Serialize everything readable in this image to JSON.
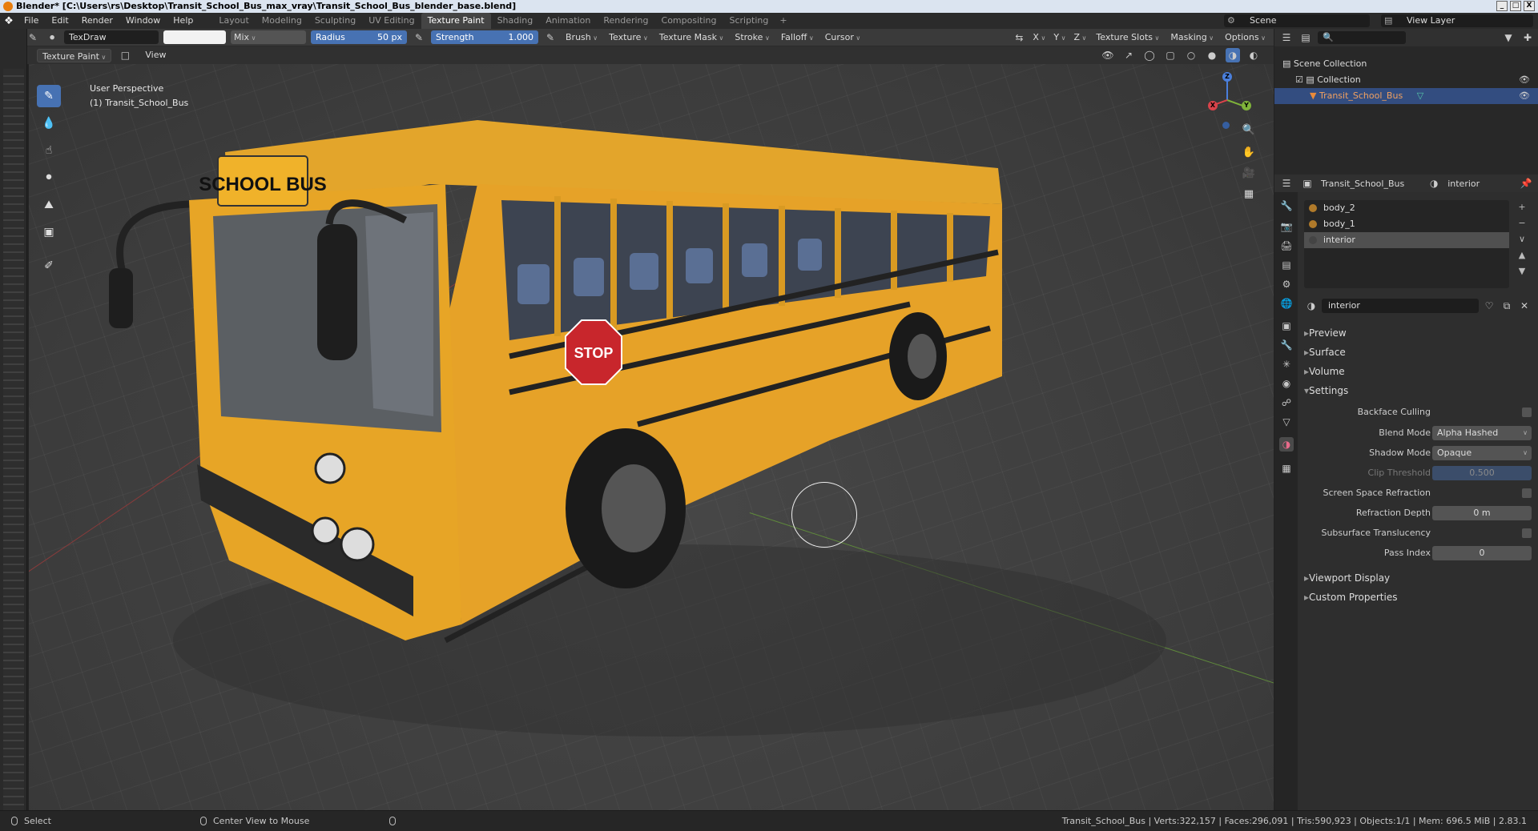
{
  "window": {
    "title": "Blender* [C:\\Users\\rs\\Desktop\\Transit_School_Bus_max_vray\\Transit_School_Bus_blender_base.blend]",
    "buttons": [
      "_",
      "□",
      "X"
    ]
  },
  "menu": [
    "File",
    "Edit",
    "Render",
    "Window",
    "Help"
  ],
  "workspace_tabs": [
    "Layout",
    "Modeling",
    "Sculpting",
    "UV Editing",
    "Texture Paint",
    "Shading",
    "Animation",
    "Rendering",
    "Compositing",
    "Scripting"
  ],
  "active_workspace": "Texture Paint",
  "scene": "Scene",
  "view_layer": "View Layer",
  "tool_header": {
    "brush_name": "TexDraw",
    "blend_mode": "Mix",
    "radius_label": "Radius",
    "radius_value": "50 px",
    "strength_label": "Strength",
    "strength_value": "1.000",
    "dropdowns": [
      "Brush",
      "Texture",
      "Texture Mask",
      "Stroke",
      "Falloff",
      "Cursor"
    ],
    "axes": [
      "X",
      "Y",
      "Z"
    ],
    "right_dropdowns": [
      "Texture Slots",
      "Masking",
      "Options"
    ]
  },
  "mode_header": {
    "mode": "Texture Paint",
    "view": "View"
  },
  "viewport": {
    "perspective": "User Perspective",
    "object": "(1) Transit_School_Bus",
    "bus_sign": "SCHOOL BUS",
    "stop_sign": "STOP",
    "gizmo": {
      "x": "X",
      "y": "Y",
      "z": "Z"
    }
  },
  "outliner": {
    "root": "Scene Collection",
    "collection": "Collection",
    "object": "Transit_School_Bus"
  },
  "properties": {
    "object": "Transit_School_Bus",
    "material": "interior",
    "slots": [
      {
        "name": "body_2",
        "color": "#b07a2a"
      },
      {
        "name": "body_1",
        "color": "#b07a2a"
      },
      {
        "name": "interior",
        "color": "#444444"
      }
    ],
    "material_name": "interior",
    "panels": {
      "preview": "Preview",
      "surface": "Surface",
      "volume": "Volume",
      "settings": "Settings",
      "viewport_display": "Viewport Display",
      "custom_properties": "Custom Properties"
    },
    "settings": {
      "backface_culling": "Backface Culling",
      "blend_mode_label": "Blend Mode",
      "blend_mode": "Alpha Hashed",
      "shadow_mode_label": "Shadow Mode",
      "shadow_mode": "Opaque",
      "clip_threshold_label": "Clip Threshold",
      "clip_threshold": "0.500",
      "ssr_label": "Screen Space Refraction",
      "refraction_depth_label": "Refraction Depth",
      "refraction_depth": "0 m",
      "subsurface_label": "Subsurface Translucency",
      "pass_index_label": "Pass Index",
      "pass_index": "0"
    }
  },
  "statusbar": {
    "left": "Select",
    "middle": "Center View to Mouse",
    "stats": "Transit_School_Bus | Verts:322,157 | Faces:296,091 | Tris:590,923 | Objects:1/1 | Mem: 696.5 MiB | 2.83.1"
  },
  "colors": {
    "accent_blue": "#4772b3",
    "selection": "#334d80",
    "bus_yellow": "#e8a423",
    "stop_red": "#c8262c"
  }
}
